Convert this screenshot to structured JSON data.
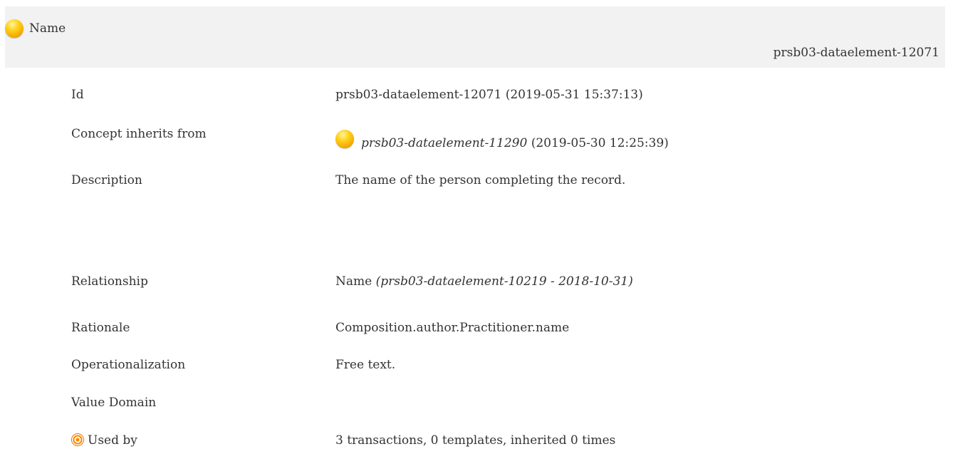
{
  "header": {
    "title": "Name",
    "identifier": "prsb03-dataelement-12071",
    "status_icon": "yellow-status-ball-icon"
  },
  "rows": {
    "id": {
      "label": "Id",
      "value": "prsb03-dataelement-12071 (2019-05-31 15:37:13)"
    },
    "inherits": {
      "label": "Concept inherits from",
      "link": "prsb03-dataelement-11290",
      "date": " (2019-05-30 12:25:39)",
      "icon": "yellow-status-ball-icon"
    },
    "description": {
      "label": "Description",
      "value": "The name of the person completing the record."
    },
    "relationship": {
      "label": "Relationship",
      "name": "Name ",
      "ref": "(prsb03-dataelement-10219 - 2018-10-31)"
    },
    "rationale": {
      "label": "Rationale",
      "value": "Composition.author.Practitioner.name"
    },
    "operationalization": {
      "label": "Operationalization",
      "value": "Free text."
    },
    "value_domain": {
      "label": "Value Domain",
      "value": ""
    },
    "used_by": {
      "label": "Used by",
      "value": "3 transactions, 0 templates, inherited 0 times",
      "icon": "target-icon"
    }
  }
}
